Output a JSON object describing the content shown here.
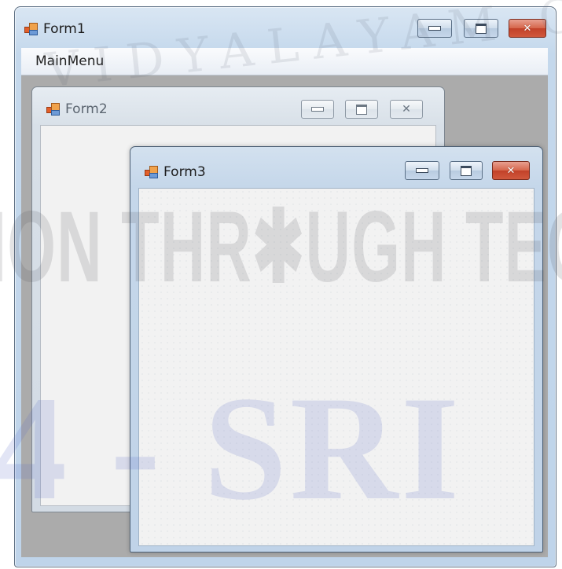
{
  "form1": {
    "title": "Form1",
    "menu": [
      "MainMenu"
    ]
  },
  "form2": {
    "title": "Form2"
  },
  "form3": {
    "title": "Form3"
  },
  "watermark": {
    "top": "VIDYALAYAM COMMUNITY",
    "middle": "ION THR✱UGH TEC",
    "bottom": "4 - SRI"
  },
  "icons": {
    "app": "app-form-icon",
    "minimize": "minimize-icon",
    "maximize": "maximize-icon",
    "close": "close-icon"
  },
  "colors": {
    "close_button": "#c94a30",
    "mdi_background": "#ababab",
    "window_frame": "#c4d8ec"
  }
}
